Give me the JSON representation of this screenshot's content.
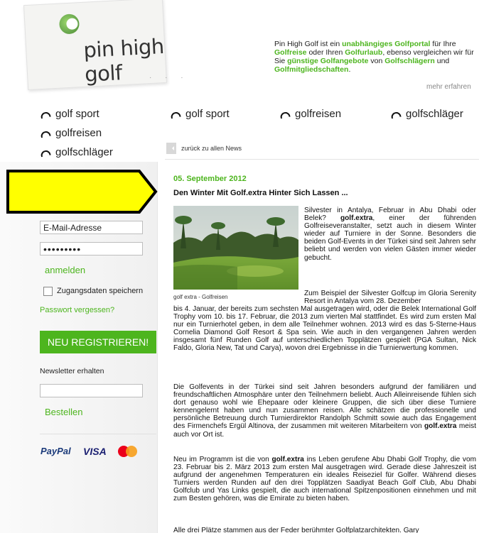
{
  "header": {
    "logo_text": "pin high golf",
    "intro": {
      "t1": "Pin High Golf ist ein ",
      "l1": "unabhängiges Golfportal",
      "t2": " für Ihre ",
      "l2": "Golfreise",
      "t3": " oder Ihren ",
      "l3": "Golfurlaub",
      "t4": ", ebenso vergleichen wir für Sie ",
      "l4": "günstige Golfangebote",
      "t5": " von ",
      "l5": "Golfschlägern",
      "t6": " und ",
      "l6": "Golfmitgliedschaften",
      "t7": "."
    },
    "more_link": "mehr erfahren"
  },
  "top_nav": [
    "golf sport",
    "golfreisen",
    "golfschläger"
  ],
  "sidebar": {
    "nav": [
      "golf sport",
      "golfreisen",
      "golfschläger"
    ],
    "email_value": "E-Mail-Adresse",
    "password_value": "•••••••••",
    "login_label": "anmelden",
    "remember_label": "Zugangsdaten speichern",
    "forgot_label": "Passwort vergessen?",
    "register_label": "NEU REGISTRIEREN!",
    "newsletter_label": "Newsletter erhalten",
    "order_label": "Bestellen",
    "payment": {
      "paypal": "PayPal",
      "visa": "VISA",
      "mastercard": "MasterCard"
    }
  },
  "article": {
    "back_link": "zurück zu allen News",
    "date": "05. September 2012",
    "title": "Den Winter Mit Golf.extra Hinter Sich Lassen ...",
    "image_caption": "golf extra - Golfreisen",
    "p1": {
      "a": "Silvester in Antalya, Februar in Abu Dhabi oder Belek? ",
      "b": "golf.extra",
      "c": ", einer der führenden Golfreiseveranstalter, setzt auch in diesem Winter wieder auf Turniere in der Sonne. Besonders die beiden Golf-Events in der Türkei sind seit Jahren sehr beliebt und werden von vielen Gästen immer wieder gebucht."
    },
    "p2a": "Zum Beispiel der Silvester Golfcup im Gloria Serenity Resort in Antalya vom 28. Dezember",
    "p2b": "bis 4. Januar, der bereits zum sechsten Mal ausgetragen wird, oder die Belek International Golf Trophy vom 10. bis 17. Februar, die 2013 zum vierten Mal stattfindet. Es wird zum ersten Mal nur ein Turnierhotel geben, in dem alle Teilnehmer wohnen. 2013 wird es das 5-Sterne-Haus Cornelia Diamond Golf Resort & Spa sein. Wie auch in den vergangenen Jahren werden insgesamt fünf Runden Golf auf unterschiedlichen Topplätzen gespielt (PGA Sultan, Nick Faldo, Gloria New, Tat und Carya), wovon drei Ergebnisse in die Turnierwertung kommen.",
    "p3": {
      "a": "Die Golfevents in der Türkei sind seit Jahren besonders aufgrund der familiären und freundschaftlichen Atmosphäre unter den Teilnehmern beliebt. Auch Alleinreisende fühlen sich dort genauso wohl wie Ehepaare oder kleinere Gruppen, die sich über diese Turniere kennengelernt haben und nun zusammen reisen. Alle schätzen die professionelle und persönliche Betreuung durch Turnierdirektor Randolph Schmitt sowie auch das Engagement des Firmenchefs Ergül Altinova, der zusammen mit weiteren Mitarbeitern von ",
      "b": "golf.extra",
      "c": " meist auch vor Ort ist."
    },
    "p4": {
      "a": "Neu im Programm ist die von ",
      "b": "golf.extra",
      "c": " ins Leben gerufene Abu Dhabi Golf Trophy, die vom 23. Februar bis 2. März 2013 zum ersten Mal ausgetragen wird. Gerade diese Jahreszeit ist aufgrund der angenehmen Temperaturen ein ideales Reiseziel für Golfer. Während dieses Turniers werden Runden auf den drei Topplätzen Saadiyat Beach Golf Club, Abu Dhabi Golfclub und Yas Links gespielt, die auch international Spitzenpositionen einnehmen und mit zum Besten gehören, was die Emirate zu bieten haben."
    },
    "p5": "Alle drei Plätze stammen aus der Feder berühmter Golfplatzarchitekten. Gary"
  },
  "colors": {
    "brand_green": "#4db51e",
    "highlight_arrow": "#ffff00"
  }
}
